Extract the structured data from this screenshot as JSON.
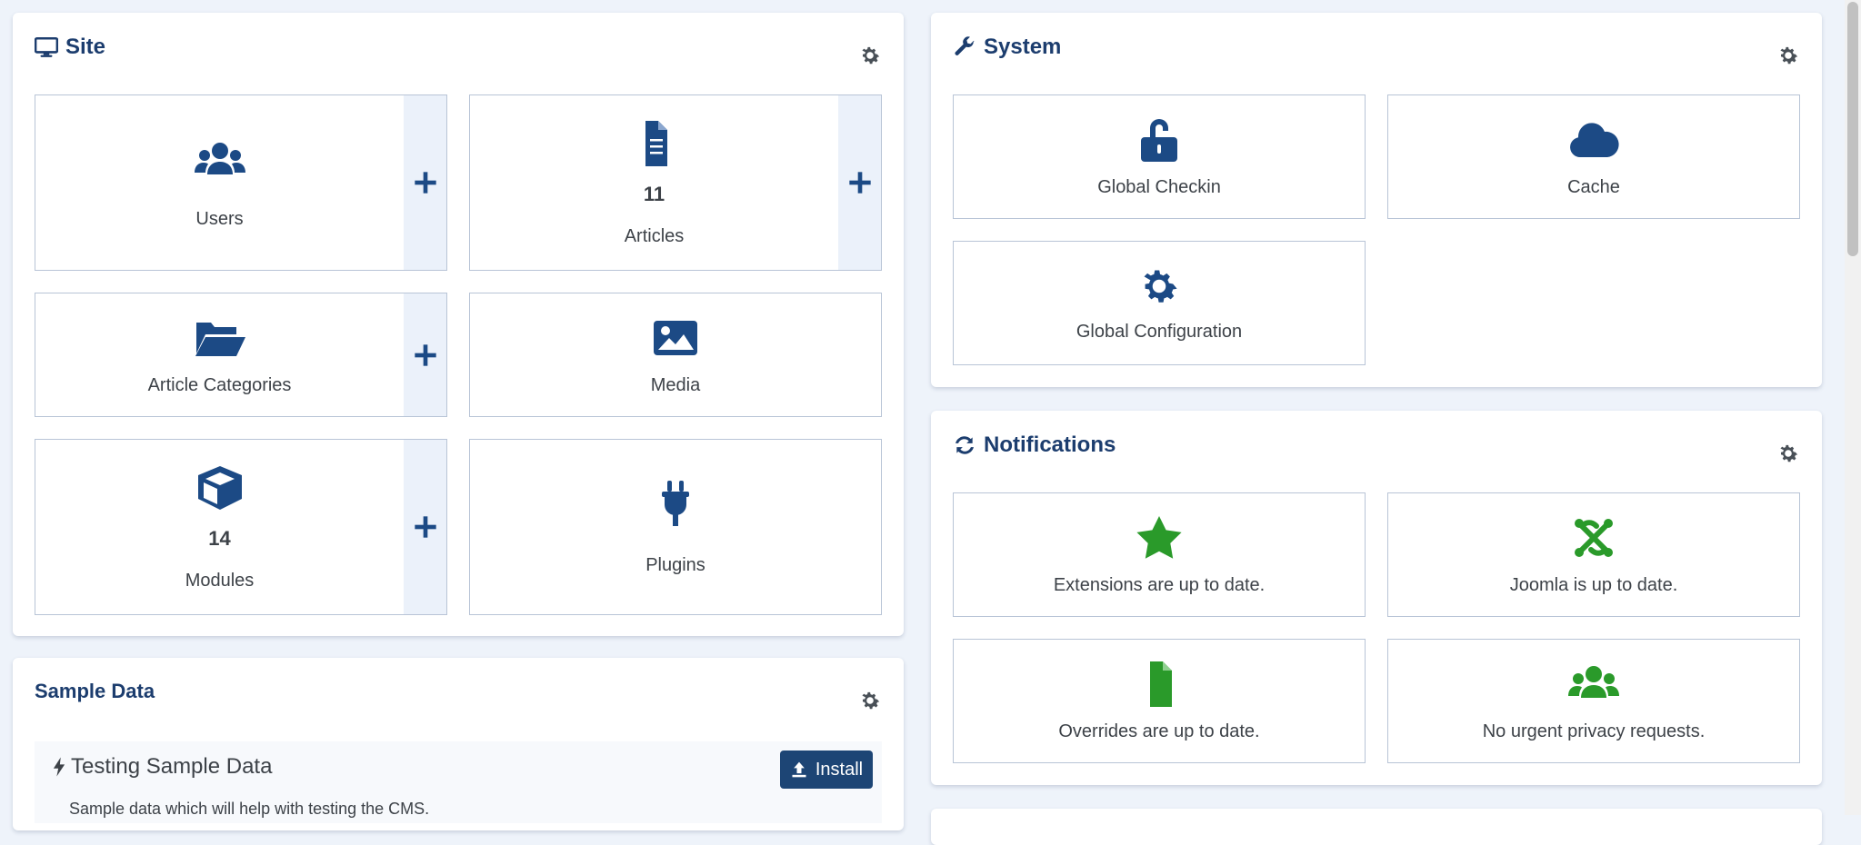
{
  "colors": {
    "accent": "#1c4a85",
    "success": "#2a9a2a",
    "title": "#1c3d6e",
    "tile_border": "#b8c4d6",
    "add_bg": "#ebf1fa"
  },
  "site": {
    "title": "Site",
    "title_icon": "desktop-icon",
    "settings_icon": "gear-icon",
    "tiles": [
      {
        "label": "Users",
        "count": "",
        "icon": "users-icon",
        "add": true
      },
      {
        "label": "Articles",
        "count": "11",
        "icon": "file-text-icon",
        "add": true
      },
      {
        "label": "Article Categories",
        "count": "",
        "icon": "folder-open-icon",
        "add": true
      },
      {
        "label": "Media",
        "count": "",
        "icon": "image-icon",
        "add": false
      },
      {
        "label": "Modules",
        "count": "14",
        "icon": "cube-icon",
        "add": true
      },
      {
        "label": "Plugins",
        "count": "",
        "icon": "plug-icon",
        "add": false
      }
    ],
    "add_label": "+"
  },
  "system": {
    "title": "System",
    "title_icon": "wrench-icon",
    "settings_icon": "gear-icon",
    "tiles": [
      {
        "label": "Global Checkin",
        "icon": "unlock-icon"
      },
      {
        "label": "Cache",
        "icon": "cloud-icon"
      },
      {
        "label": "Global Configuration",
        "icon": "cog-icon"
      }
    ]
  },
  "notifications": {
    "title": "Notifications",
    "title_icon": "sync-icon",
    "settings_icon": "gear-icon",
    "tiles": [
      {
        "label": "Extensions are up to date.",
        "icon": "star-icon"
      },
      {
        "label": "Joomla is up to date.",
        "icon": "joomla-icon"
      },
      {
        "label": "Overrides are up to date.",
        "icon": "file-icon"
      },
      {
        "label": "No urgent privacy requests.",
        "icon": "users-icon"
      }
    ]
  },
  "sample_data": {
    "title": "Sample Data",
    "settings_icon": "gear-icon",
    "item_title": "Testing Sample Data",
    "item_icon": "bolt-icon",
    "item_description": "Sample data which will help with testing the CMS.",
    "install_label": "Install",
    "install_icon": "upload-icon"
  }
}
